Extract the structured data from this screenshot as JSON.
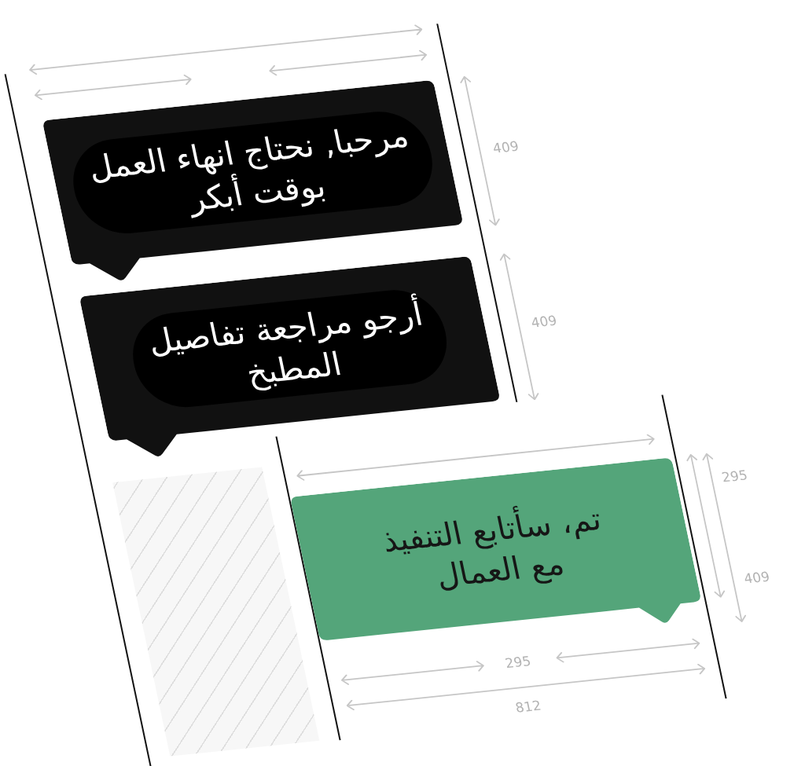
{
  "message_column": {
    "messages": [
      {
        "lines": [
          "مرحبا, نحتاج انهاء العمل",
          "بوقت أبكر"
        ]
      },
      {
        "lines": [
          "أرجو مراجعة تفاصيل",
          "المطبخ"
        ]
      }
    ],
    "height_labels": [
      "409",
      "409"
    ]
  },
  "reply_column": {
    "message": {
      "lines": [
        "تم، سأتابع التنفيذ",
        "مع العمال"
      ]
    },
    "height_labels": [
      "295",
      "409"
    ],
    "width_label": "295",
    "total_width_label": "812"
  }
}
